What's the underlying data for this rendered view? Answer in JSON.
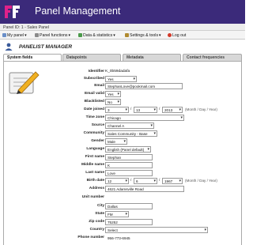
{
  "app": {
    "title": "Panel Management",
    "brand_color": "#3b2a7a"
  },
  "panel_id": "Panel ID: 1 - Sales Panel",
  "menu": [
    {
      "label": "My panel",
      "icon": "home-icon"
    },
    {
      "label": "Panel functions",
      "icon": "gear-icon"
    },
    {
      "label": "Data & statistics",
      "icon": "chart-icon"
    },
    {
      "label": "Settings & tools",
      "icon": "tools-icon"
    },
    {
      "label": "Log out",
      "icon": "logout-icon"
    }
  ],
  "page_title": "PANELIST MANAGER",
  "tabs": [
    "System fields",
    "Datapoints",
    "Metadata",
    "Contact frequencies"
  ],
  "fields": {
    "identifier": {
      "label": "Identifier",
      "value": "K_0b59dadafa"
    },
    "subscribed": {
      "label": "Subscribed",
      "value": "Yes"
    },
    "email": {
      "label": "Email",
      "value": "StephanLove@pookmail.com"
    },
    "email_valid": {
      "label": "Email valid",
      "value": "Yes"
    },
    "blacklisted": {
      "label": "Blacklisted",
      "value": "No"
    },
    "date_joined": {
      "label": "Date joined",
      "month": "3",
      "day": "13",
      "year": "2013",
      "hint": "(Month / Day / Year)"
    },
    "time_zone": {
      "label": "Time zone",
      "value": "Chicago"
    },
    "source": {
      "label": "Source",
      "value": "Channel A"
    },
    "community": {
      "label": "Community",
      "value": "Sales Community - Base"
    },
    "gender": {
      "label": "Gender",
      "value": "Male"
    },
    "language": {
      "label": "Language",
      "value": "English (Panel default)"
    },
    "first_name": {
      "label": "First name",
      "value": "Stephan"
    },
    "middle_name": {
      "label": "Middle name",
      "value": "K"
    },
    "last_name": {
      "label": "Last name",
      "value": "Love"
    },
    "birth_date": {
      "label": "Birth date",
      "month": "12",
      "day": "6",
      "year": "1967",
      "hint": "(Month / Day / Year)"
    },
    "address": {
      "label": "Address",
      "value": "4621 Adamsville Road"
    },
    "unit_number": {
      "label": "Unit number",
      "value": ""
    },
    "city": {
      "label": "City",
      "value": "Dallas"
    },
    "state": {
      "label": "State",
      "value": "FM"
    },
    "zip_code": {
      "label": "Zip code",
      "value": "75252"
    },
    "country": {
      "label": "Country",
      "value": "Select"
    },
    "phone_number": {
      "label": "Phone number",
      "value": "956-773-6945"
    }
  },
  "date_separator": "/"
}
